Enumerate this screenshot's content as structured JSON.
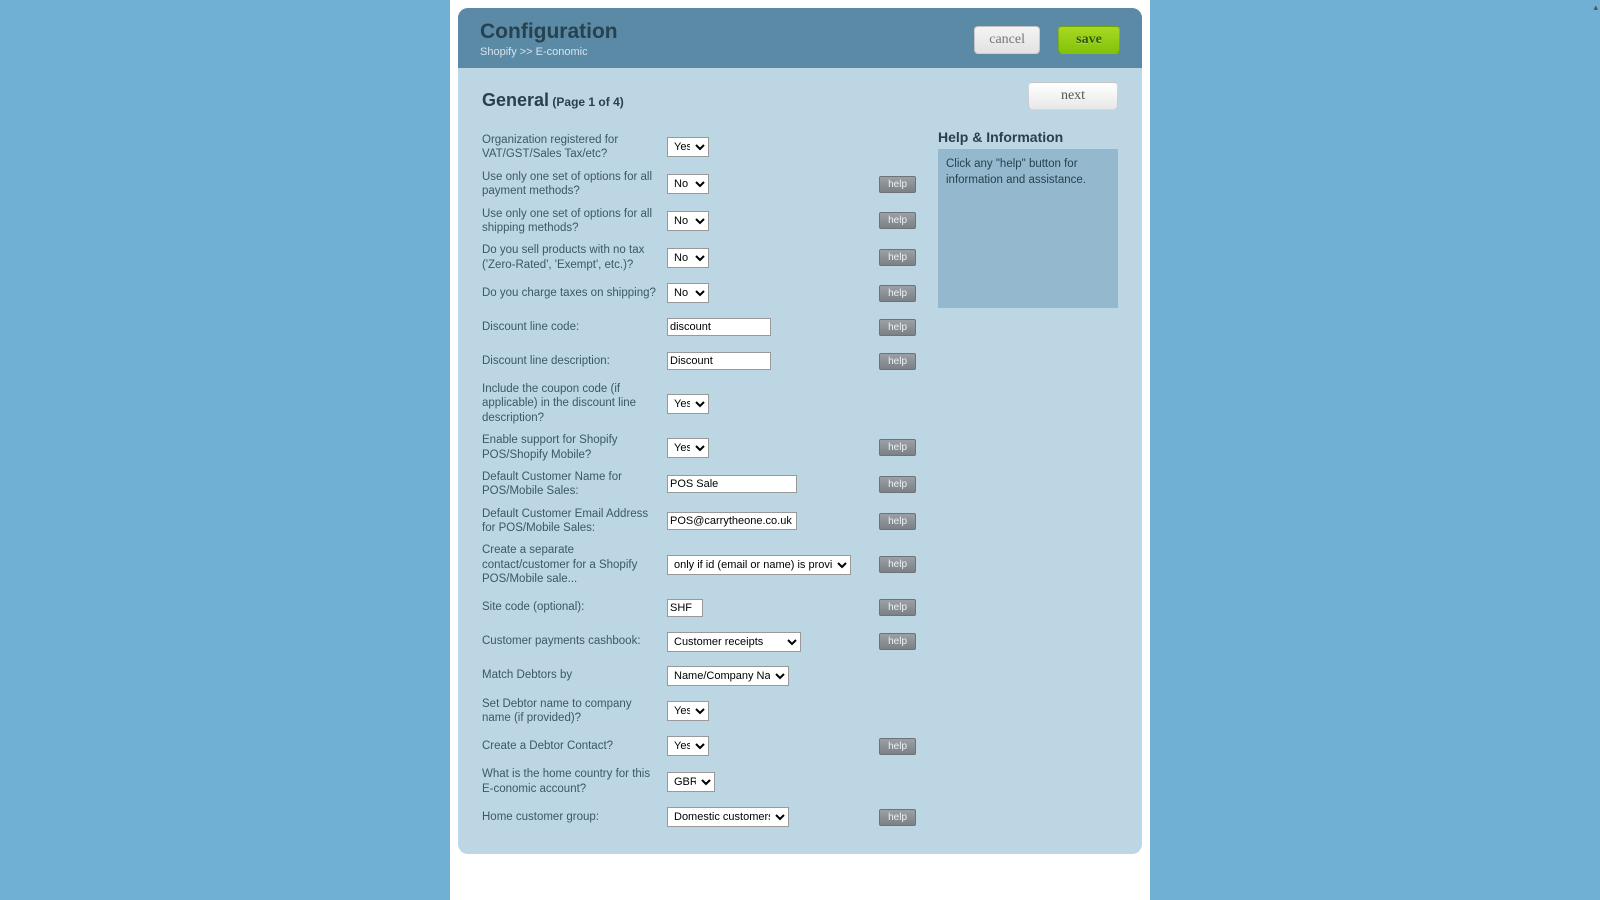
{
  "header": {
    "title": "Configuration",
    "breadcrumb": "Shopify >> E-conomic",
    "cancel_label": "cancel",
    "save_label": "save"
  },
  "section": {
    "title": "General",
    "pager": "(Page 1 of 4)",
    "next_label": "next"
  },
  "help_panel": {
    "title": "Help & Information",
    "body": "Click any \"help\" button for information and assistance."
  },
  "help_label": "help",
  "rows": [
    {
      "label": "Organization registered for VAT/GST/Sales Tax/etc?",
      "type": "select",
      "value": "Yes",
      "width": "small",
      "help": false
    },
    {
      "label": "Use only one set of options for all payment methods?",
      "type": "select",
      "value": "No",
      "width": "small",
      "help": true
    },
    {
      "label": "Use only one set of options for all shipping methods?",
      "type": "select",
      "value": "No",
      "width": "small",
      "help": true
    },
    {
      "label": "Do you sell products with no tax ('Zero-Rated', 'Exempt', etc.)?",
      "type": "select",
      "value": "No",
      "width": "small",
      "help": true
    },
    {
      "label": "Do you charge taxes on shipping?",
      "type": "select",
      "value": "No",
      "width": "small",
      "help": true
    },
    {
      "label": "Discount line code:",
      "type": "text",
      "value": "discount",
      "width": "text-med",
      "help": true
    },
    {
      "label": "Discount line description:",
      "type": "text",
      "value": "Discount",
      "width": "text-med",
      "help": true
    },
    {
      "label": "Include the coupon code (if applicable) in the discount line description?",
      "type": "select",
      "value": "Yes",
      "width": "small",
      "help": false
    },
    {
      "label": "Enable support for Shopify POS/Shopify Mobile?",
      "type": "select",
      "value": "Yes",
      "width": "small",
      "help": true
    },
    {
      "label": "Default Customer Name for POS/Mobile Sales:",
      "type": "text",
      "value": "POS Sale",
      "width": "text-lg",
      "help": true
    },
    {
      "label": "Default Customer Email Address for POS/Mobile Sales:",
      "type": "text",
      "value": "POS@carrytheone.co.uk",
      "width": "text-lg",
      "help": true
    },
    {
      "label": "Create a separate contact/customer for a Shopify POS/Mobile sale...",
      "type": "select",
      "value": "only if id (email or name) is provided",
      "width": "wider",
      "help": true
    },
    {
      "label": "Site code (optional):",
      "type": "text",
      "value": "SHF",
      "width": "text-sm",
      "help": true
    },
    {
      "label": "Customer payments cashbook:",
      "type": "select",
      "value": "Customer receipts",
      "width": "wide",
      "help": true
    },
    {
      "label": "Match Debtors by",
      "type": "select",
      "value": "Name/Company Name",
      "width": "mid",
      "help": false
    },
    {
      "label": "Set Debtor name to company name (if provided)?",
      "type": "select",
      "value": "Yes",
      "width": "small",
      "help": false
    },
    {
      "label": "Create a Debtor Contact?",
      "type": "select",
      "value": "Yes",
      "width": "small",
      "help": true
    },
    {
      "label": "What is the home country for this E-conomic account?",
      "type": "select",
      "value": "GBR",
      "width": "med",
      "help": false
    },
    {
      "label": "Home customer group:",
      "type": "select",
      "value": "Domestic customers",
      "width": "mid",
      "help": true
    }
  ]
}
